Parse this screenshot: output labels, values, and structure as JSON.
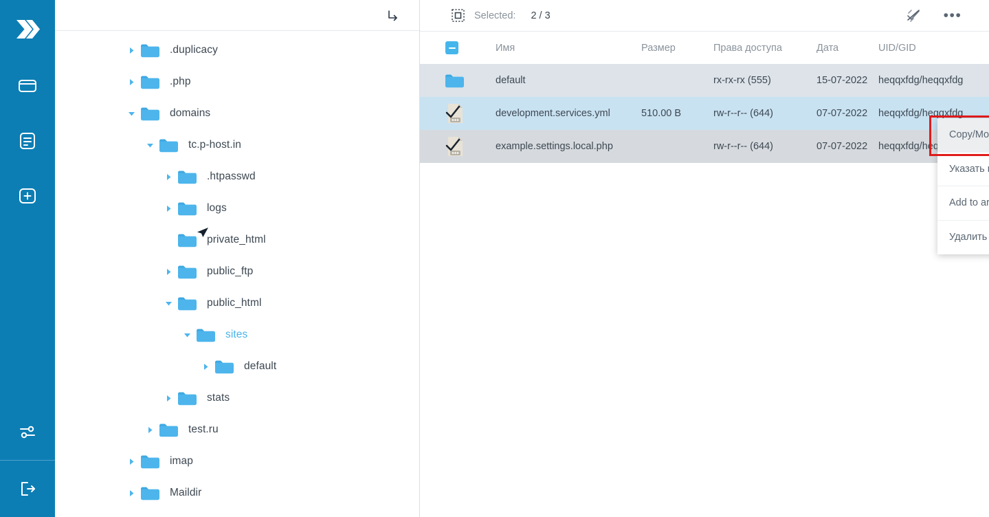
{
  "app": {
    "logo_icon": "double-chevron-right-logo",
    "brand_color": "#0c7eb4",
    "accent_color": "#45b6ec",
    "selected_row_color": "#c9e2f2",
    "highlight_border_color": "#e01b1b"
  },
  "rail": {
    "items": [
      {
        "icon": "folder-icon",
        "name": "file-manager"
      },
      {
        "icon": "document-icon",
        "name": "logs"
      },
      {
        "icon": "plus-square-icon",
        "name": "create-new"
      }
    ],
    "bottom_items": [
      {
        "icon": "sliders-icon",
        "name": "settings"
      },
      {
        "icon": "logout-icon",
        "name": "logout"
      }
    ]
  },
  "tree": {
    "toolbar": {
      "go_icon": "enter-directory-arrow-icon"
    },
    "nodes": [
      {
        "label": ".duplicacy",
        "depth": 1,
        "state": "collapsed",
        "selected": false
      },
      {
        "label": ".php",
        "depth": 1,
        "state": "collapsed",
        "selected": false
      },
      {
        "label": "domains",
        "depth": 1,
        "state": "expanded",
        "selected": false
      },
      {
        "label": "tc.p-host.in",
        "depth": 2,
        "state": "expanded",
        "selected": false
      },
      {
        "label": ".htpasswd",
        "depth": 3,
        "state": "collapsed",
        "selected": false
      },
      {
        "label": "logs",
        "depth": 3,
        "state": "collapsed",
        "selected": false
      },
      {
        "label": "private_html",
        "depth": 3,
        "state": "leaf",
        "selected": false
      },
      {
        "label": "public_ftp",
        "depth": 3,
        "state": "collapsed",
        "selected": false
      },
      {
        "label": "public_html",
        "depth": 3,
        "state": "expanded",
        "selected": false
      },
      {
        "label": "sites",
        "depth": 4,
        "state": "expanded",
        "selected": true
      },
      {
        "label": "default",
        "depth": 5,
        "state": "collapsed",
        "selected": false
      },
      {
        "label": "stats",
        "depth": 3,
        "state": "collapsed",
        "selected": false
      },
      {
        "label": "test.ru",
        "depth": 2,
        "state": "collapsed",
        "selected": false
      },
      {
        "label": "imap",
        "depth": 1,
        "state": "collapsed",
        "selected": false
      },
      {
        "label": "Maildir",
        "depth": 1,
        "state": "collapsed",
        "selected": false
      }
    ]
  },
  "list": {
    "toolbar": {
      "selection_icon": "selection-marquee-icon",
      "selected_label": "Selected:",
      "selected_count": "2 / 3",
      "deselect_icon": "deselect-all-icon",
      "more_icon": "more-horizontal-icon"
    },
    "columns": [
      "Имя",
      "Размер",
      "Права доступа",
      "Дата",
      "UID/GID"
    ],
    "header_checkbox_state": "indeterminate",
    "rows": [
      {
        "icon": "folder-icon",
        "name": "default",
        "size": "",
        "permissions": "rx-rx-rx (555)",
        "date": "15-07-2022",
        "uid_gid": "heqqxfdg/heqqxfdg",
        "checked": false,
        "row_style": "alt"
      },
      {
        "icon": "file-checked-icon",
        "name": "development.services.yml",
        "size": "510.00 B",
        "permissions": "rw-r--r-- (644)",
        "date": "07-07-2022",
        "uid_gid": "heqqxfdg/heqqxfdg",
        "checked": true,
        "row_style": "selected"
      },
      {
        "icon": "file-checked-icon",
        "name": "example.settings.local.php",
        "size": "",
        "permissions": "rw-r--r-- (644)",
        "date": "07-07-2022",
        "uid_gid": "heqqxfdg/heqqxfdg",
        "checked": true,
        "row_style": "alt2"
      }
    ]
  },
  "context_menu": {
    "items": [
      {
        "label": "Copy/Move to...",
        "hover": true
      },
      {
        "label": "Указать права доступа",
        "hover": false
      },
      {
        "label": "Add to archive",
        "hover": false
      },
      {
        "label": "Удалить",
        "hover": false
      }
    ]
  }
}
